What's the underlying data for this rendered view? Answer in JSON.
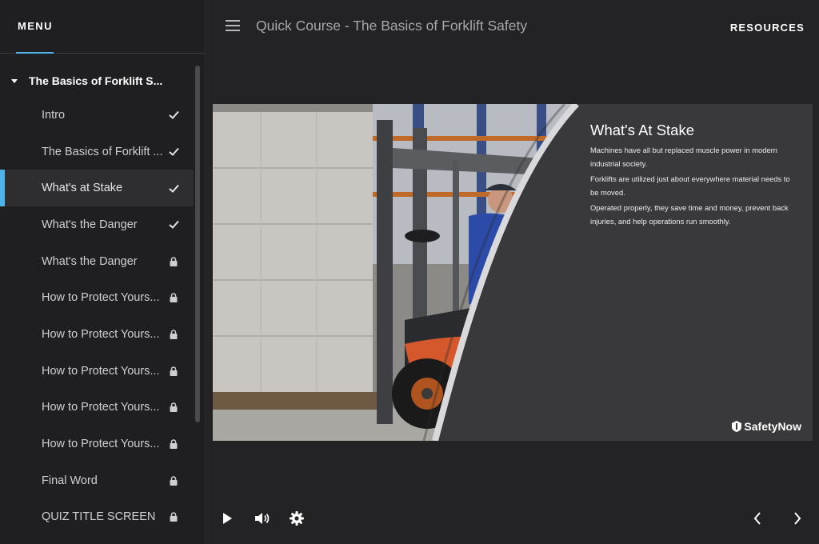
{
  "sidebar": {
    "tab_label": "MENU",
    "section_title": "The Basics of Forklift S...",
    "items": [
      {
        "label": "Intro",
        "status": "check-icon"
      },
      {
        "label": "The Basics of Forklift ...",
        "status": "check-icon"
      },
      {
        "label": "What's at Stake",
        "status": "check-icon",
        "active": true
      },
      {
        "label": "What's the Danger",
        "status": "check-icon"
      },
      {
        "label": "What's the Danger",
        "status": "lock-icon"
      },
      {
        "label": "How to Protect Yours...",
        "status": "lock-icon"
      },
      {
        "label": "How to Protect Yours...",
        "status": "lock-icon"
      },
      {
        "label": "How to Protect Yours...",
        "status": "lock-icon"
      },
      {
        "label": "How to Protect Yours...",
        "status": "lock-icon"
      },
      {
        "label": "How to Protect Yours...",
        "status": "lock-icon"
      },
      {
        "label": "Final Word",
        "status": "lock-icon"
      },
      {
        "label": "QUIZ TITLE SCREEN",
        "status": "lock-icon"
      }
    ]
  },
  "header": {
    "course_title": "Quick Course - The Basics of Forklift Safety",
    "resources_label": "RESOURCES"
  },
  "slide": {
    "heading": "What's At Stake",
    "paragraphs": [
      "Machines have all but replaced muscle power in modern industrial society.",
      "Forklifts are utilized just about everywhere material needs to be moved.",
      "Operated properly, they save time and money, prevent back injuries, and help operations run smoothly."
    ],
    "logo_text": "SafetyNow"
  },
  "controls": {
    "left": [
      "play-icon",
      "volume-icon",
      "settings-gear-icon"
    ],
    "right": [
      "previous-chevron-icon",
      "next-chevron-icon"
    ]
  },
  "colors": {
    "accent": "#4fb3e8",
    "background": "#232325",
    "slide_panel": "#39393b"
  }
}
